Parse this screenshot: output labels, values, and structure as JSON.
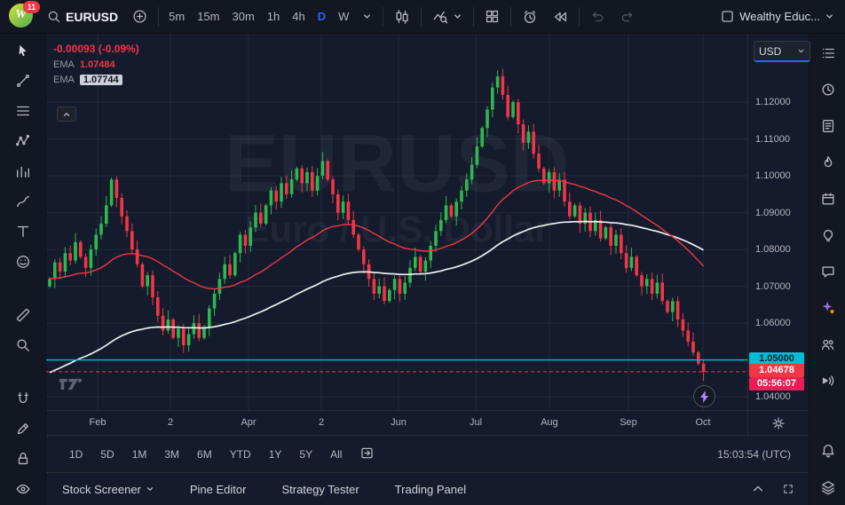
{
  "topbar": {
    "notification_count": "11",
    "symbol": "EURUSD",
    "timeframes": [
      "5m",
      "15m",
      "30m",
      "1h",
      "4h",
      "D",
      "W"
    ],
    "active_timeframe": "D",
    "account_name": "Wealthy Educ..."
  },
  "chart": {
    "change_text": "-0.00093 (-0.09%)",
    "indicators": [
      {
        "label": "EMA",
        "value": "1.07484"
      },
      {
        "label": "EMA",
        "value": "1.07744"
      }
    ],
    "watermark_title": "EURUSD",
    "watermark_subtitle": "Euro / U.S. Dollar",
    "currency_selector": "USD"
  },
  "price_axis": {
    "ticks": [
      "1.12000",
      "1.11000",
      "1.10000",
      "1.09000",
      "1.08000",
      "1.07000",
      "1.06000",
      "1.04000"
    ],
    "level_label": "1.05000",
    "last_price": "1.04678",
    "countdown": "05:56:07"
  },
  "range_bar": {
    "ranges": [
      "1D",
      "5D",
      "1M",
      "3M",
      "6M",
      "YTD",
      "1Y",
      "5Y",
      "All"
    ],
    "clock": "15:03:54 (UTC)"
  },
  "footer": {
    "items": [
      "Stock Screener",
      "Pine Editor",
      "Strategy Tester",
      "Trading Panel"
    ]
  },
  "chart_data": {
    "type": "candlestick",
    "symbol": "EURUSD",
    "timeframe": "D",
    "y_range": [
      1.0364,
      1.1386
    ],
    "price_gridlines": [
      1.04,
      1.05,
      1.06,
      1.07,
      1.08,
      1.09,
      1.1,
      1.11,
      1.12
    ],
    "month_ticks": [
      {
        "label": "Feb",
        "x": 58
      },
      {
        "label": "2",
        "x": 140
      },
      {
        "label": "Apr",
        "x": 228
      },
      {
        "label": "2",
        "x": 310
      },
      {
        "label": "Jun",
        "x": 397
      },
      {
        "label": "Jul",
        "x": 484
      },
      {
        "label": "Aug",
        "x": 567
      },
      {
        "label": "Sep",
        "x": 656
      },
      {
        "label": "Oct",
        "x": 740
      }
    ],
    "level_line": {
      "price": 1.05,
      "color": "#00bcd4"
    },
    "last_price_line": {
      "price": 1.04678,
      "color": "#f23645"
    },
    "first_open": 1.07,
    "closes": [
      1.072,
      1.0765,
      1.074,
      1.079,
      1.077,
      1.082,
      1.078,
      1.075,
      1.08,
      1.084,
      1.087,
      1.092,
      1.099,
      1.094,
      1.089,
      1.085,
      1.08,
      1.076,
      1.07,
      1.073,
      1.067,
      1.062,
      1.058,
      1.061,
      1.056,
      1.0585,
      1.054,
      1.057,
      1.06,
      1.056,
      1.059,
      1.064,
      1.068,
      1.072,
      1.076,
      1.073,
      1.079,
      1.084,
      1.081,
      1.086,
      1.09,
      1.087,
      1.092,
      1.096,
      1.093,
      1.098,
      1.095,
      1.099,
      1.102,
      1.098,
      1.101,
      1.096,
      1.1,
      1.104,
      1.099,
      1.095,
      1.09,
      1.093,
      1.088,
      1.084,
      1.08,
      1.076,
      1.072,
      1.068,
      1.07,
      1.066,
      1.069,
      1.072,
      1.068,
      1.071,
      1.075,
      1.078,
      1.074,
      1.077,
      1.081,
      1.085,
      1.088,
      1.092,
      1.089,
      1.093,
      1.096,
      1.099,
      1.103,
      1.108,
      1.113,
      1.118,
      1.124,
      1.127,
      1.122,
      1.116,
      1.12,
      1.114,
      1.109,
      1.112,
      1.106,
      1.102,
      1.098,
      1.101,
      1.096,
      1.099,
      1.093,
      1.089,
      1.092,
      1.087,
      1.09,
      1.085,
      1.088,
      1.083,
      1.086,
      1.081,
      1.084,
      1.079,
      1.075,
      1.078,
      1.073,
      1.07,
      1.072,
      1.068,
      1.071,
      1.066,
      1.063,
      1.066,
      1.061,
      1.058,
      1.055,
      1.052,
      1.049,
      1.0468
    ],
    "ema_fast": {
      "k": 0.05,
      "color": "#f23645",
      "label_value": "1.07484"
    },
    "ema_slow": {
      "k": 0.022,
      "seed": 1.046,
      "color": "#eceff1",
      "label_value": "1.07744"
    },
    "colors": {
      "up": "#2eb850",
      "down": "#f23645",
      "grid": "rgba(134,150,180,0.12)",
      "accent_blue": "#2962ff",
      "cyan": "#00bcd4",
      "last_price_red": "#f23645",
      "countdown_pink": "#e91e57"
    }
  }
}
